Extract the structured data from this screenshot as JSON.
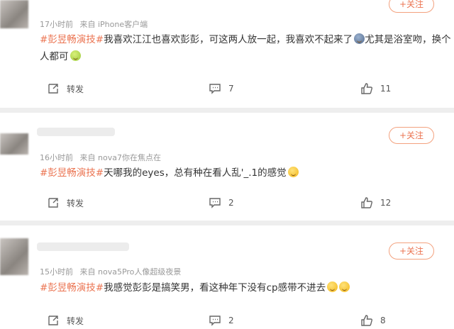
{
  "posts": [
    {
      "meta": {
        "time": "17小时前",
        "source": "来自 iPhone客户端"
      },
      "text_before": "",
      "hashtag": "#彭昱畅演技#",
      "text_main": "我喜欢江江也喜欢彭彭，可这两人放一起，我喜欢不起来了",
      "text_after": "尤其是浴室吻，换个人都可",
      "follow_label": "+关注",
      "repost_label": "转发",
      "comments": "7",
      "likes": "11"
    },
    {
      "meta": {
        "time": "16小时前",
        "source": "来自 nova7你在焦点在"
      },
      "hashtag": "#彭昱畅演技#",
      "text_main": "天哪我的eyes，总有种在看人乱'_.1的感觉",
      "follow_label": "+关注",
      "repost_label": "转发",
      "comments": "2",
      "likes": "12"
    },
    {
      "meta": {
        "time": "15小时前",
        "source": "来自 nova5Pro人像超级夜景"
      },
      "hashtag": "#彭昱畅演技#",
      "text_main": "我感觉彭彭是搞笑男，看这种年下没有cp感带不进去",
      "follow_label": "+关注",
      "repost_label": "转发",
      "comments": "2",
      "likes": "8"
    }
  ],
  "colors": {
    "accent": "#eb7350",
    "text": "#333333",
    "meta": "#999999",
    "divider": "#eeeeee"
  },
  "icons": [
    "repost-icon",
    "comment-icon",
    "like-icon",
    "emoji-icon"
  ]
}
